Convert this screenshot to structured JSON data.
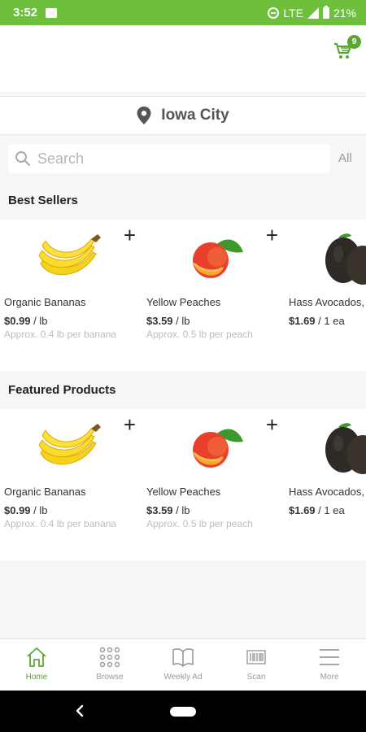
{
  "status_bar": {
    "time": "3:52",
    "network": "LTE",
    "battery": "21%"
  },
  "header": {
    "cart_count": "9"
  },
  "location": {
    "city": "Iowa City"
  },
  "search": {
    "placeholder": "Search",
    "scope": "All"
  },
  "colors": {
    "brand_green": "#6dbf3c",
    "accent_green": "#5aa833"
  },
  "sections": [
    {
      "title": "Best Sellers",
      "products": [
        {
          "name": "Organic Bananas",
          "price": "$0.99",
          "unit": " / lb",
          "approx": "Approx. 0.4 lb per banana",
          "icon": "banana-image"
        },
        {
          "name": "Yellow Peaches",
          "price": "$3.59",
          "unit": " / lb",
          "approx": "Approx. 0.5 lb per peach",
          "icon": "peach-image"
        },
        {
          "name": "Hass Avocados,",
          "price": "$1.69",
          "unit": " / 1 ea",
          "approx": "",
          "icon": "avocado-image"
        }
      ]
    },
    {
      "title": "Featured Products",
      "products": [
        {
          "name": "Organic Bananas",
          "price": "$0.99",
          "unit": " / lb",
          "approx": "Approx. 0.4 lb per banana",
          "icon": "banana-image"
        },
        {
          "name": "Yellow Peaches",
          "price": "$3.59",
          "unit": " / lb",
          "approx": "Approx. 0.5 lb per peach",
          "icon": "peach-image"
        },
        {
          "name": "Hass Avocados,",
          "price": "$1.69",
          "unit": " / 1 ea",
          "approx": "",
          "icon": "avocado-image"
        }
      ]
    }
  ],
  "add_symbol": "+",
  "bottom_nav": [
    {
      "label": "Home",
      "icon": "home-icon",
      "active": true
    },
    {
      "label": "Browse",
      "icon": "grid-icon",
      "active": false
    },
    {
      "label": "Weekly Ad",
      "icon": "book-icon",
      "active": false
    },
    {
      "label": "Scan",
      "icon": "barcode-icon",
      "active": false
    },
    {
      "label": "More",
      "icon": "menu-icon",
      "active": false
    }
  ]
}
